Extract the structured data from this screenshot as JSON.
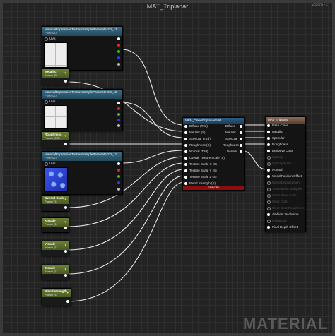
{
  "window": {
    "title": "MAT_Triplanar",
    "zoom": "Zoom -1",
    "watermark": "MATERIAL"
  },
  "texture_nodes": [
    {
      "title": "MaterialExpressionTextureSampleParameter2D_13",
      "subtitle": "Param2D",
      "uv_label": "UVs",
      "preview": "checker"
    },
    {
      "title": "MaterialExpressionTextureSampleParameter2D_12",
      "subtitle": "Param2D",
      "uv_label": "UVs",
      "preview": "checker"
    },
    {
      "title": "MaterialExpressionTextureSampleParameter2D_11",
      "subtitle": "Param2D",
      "uv_label": "UVs",
      "preview": "normal"
    }
  ],
  "scalar_nodes": [
    {
      "title": "Metallic",
      "subtitle": "Param (0)"
    },
    {
      "title": "Roughness",
      "subtitle": "Param (0.5)"
    },
    {
      "title": "Overall Scale",
      "subtitle": "Param (1)"
    },
    {
      "title": "X scale",
      "subtitle": "Param (1)"
    },
    {
      "title": "Y scale",
      "subtitle": "Param (1)"
    },
    {
      "title": "Z scale",
      "subtitle": "Param (1)"
    },
    {
      "title": "Blend strength",
      "subtitle": "Param (1)"
    }
  ],
  "function_node": {
    "title": "MFN_ClevelTriplanarEdit",
    "inputs": [
      "Diffuse (T2d)",
      "Metallic (S)",
      "Specular (T2d)",
      "Roughness (S)",
      "Normal (T2d)",
      "Overall Texture Scale (S)",
      "Texture Scale X (S)",
      "Texture Scale Y (S)",
      "Texture Scale Z (S)",
      "Blend Strength (S)"
    ],
    "outputs": [
      "Diffuse",
      "Metallic",
      "Specular",
      "Roughness",
      "Normal"
    ],
    "error": "ERROR!"
  },
  "material_node": {
    "title": "MAT_Triplanar",
    "pins": [
      {
        "label": "Base Color",
        "enabled": true
      },
      {
        "label": "Metallic",
        "enabled": true
      },
      {
        "label": "Specular",
        "enabled": true
      },
      {
        "label": "Roughness",
        "enabled": true
      },
      {
        "label": "Emissive Color",
        "enabled": true
      },
      {
        "label": "Opacity",
        "enabled": false
      },
      {
        "label": "Opacity Mask",
        "enabled": false
      },
      {
        "label": "Normal",
        "enabled": true
      },
      {
        "label": "World Position Offset",
        "enabled": true
      },
      {
        "label": "World Displacement",
        "enabled": false
      },
      {
        "label": "Tessellation Multiplier",
        "enabled": false
      },
      {
        "label": "Subsurface Color",
        "enabled": false
      },
      {
        "label": "Clear Coat",
        "enabled": false
      },
      {
        "label": "Clear Coat Roughness",
        "enabled": false
      },
      {
        "label": "Ambient Occlusion",
        "enabled": true
      },
      {
        "label": "Refraction",
        "enabled": false
      },
      {
        "label": "Pixel Depth Offset",
        "enabled": true
      }
    ]
  },
  "colors": {
    "wire": "#e8e8e8",
    "error": "#8b0d0d",
    "texture_header": "#2e6078",
    "scalar_header": "#5f7430"
  }
}
